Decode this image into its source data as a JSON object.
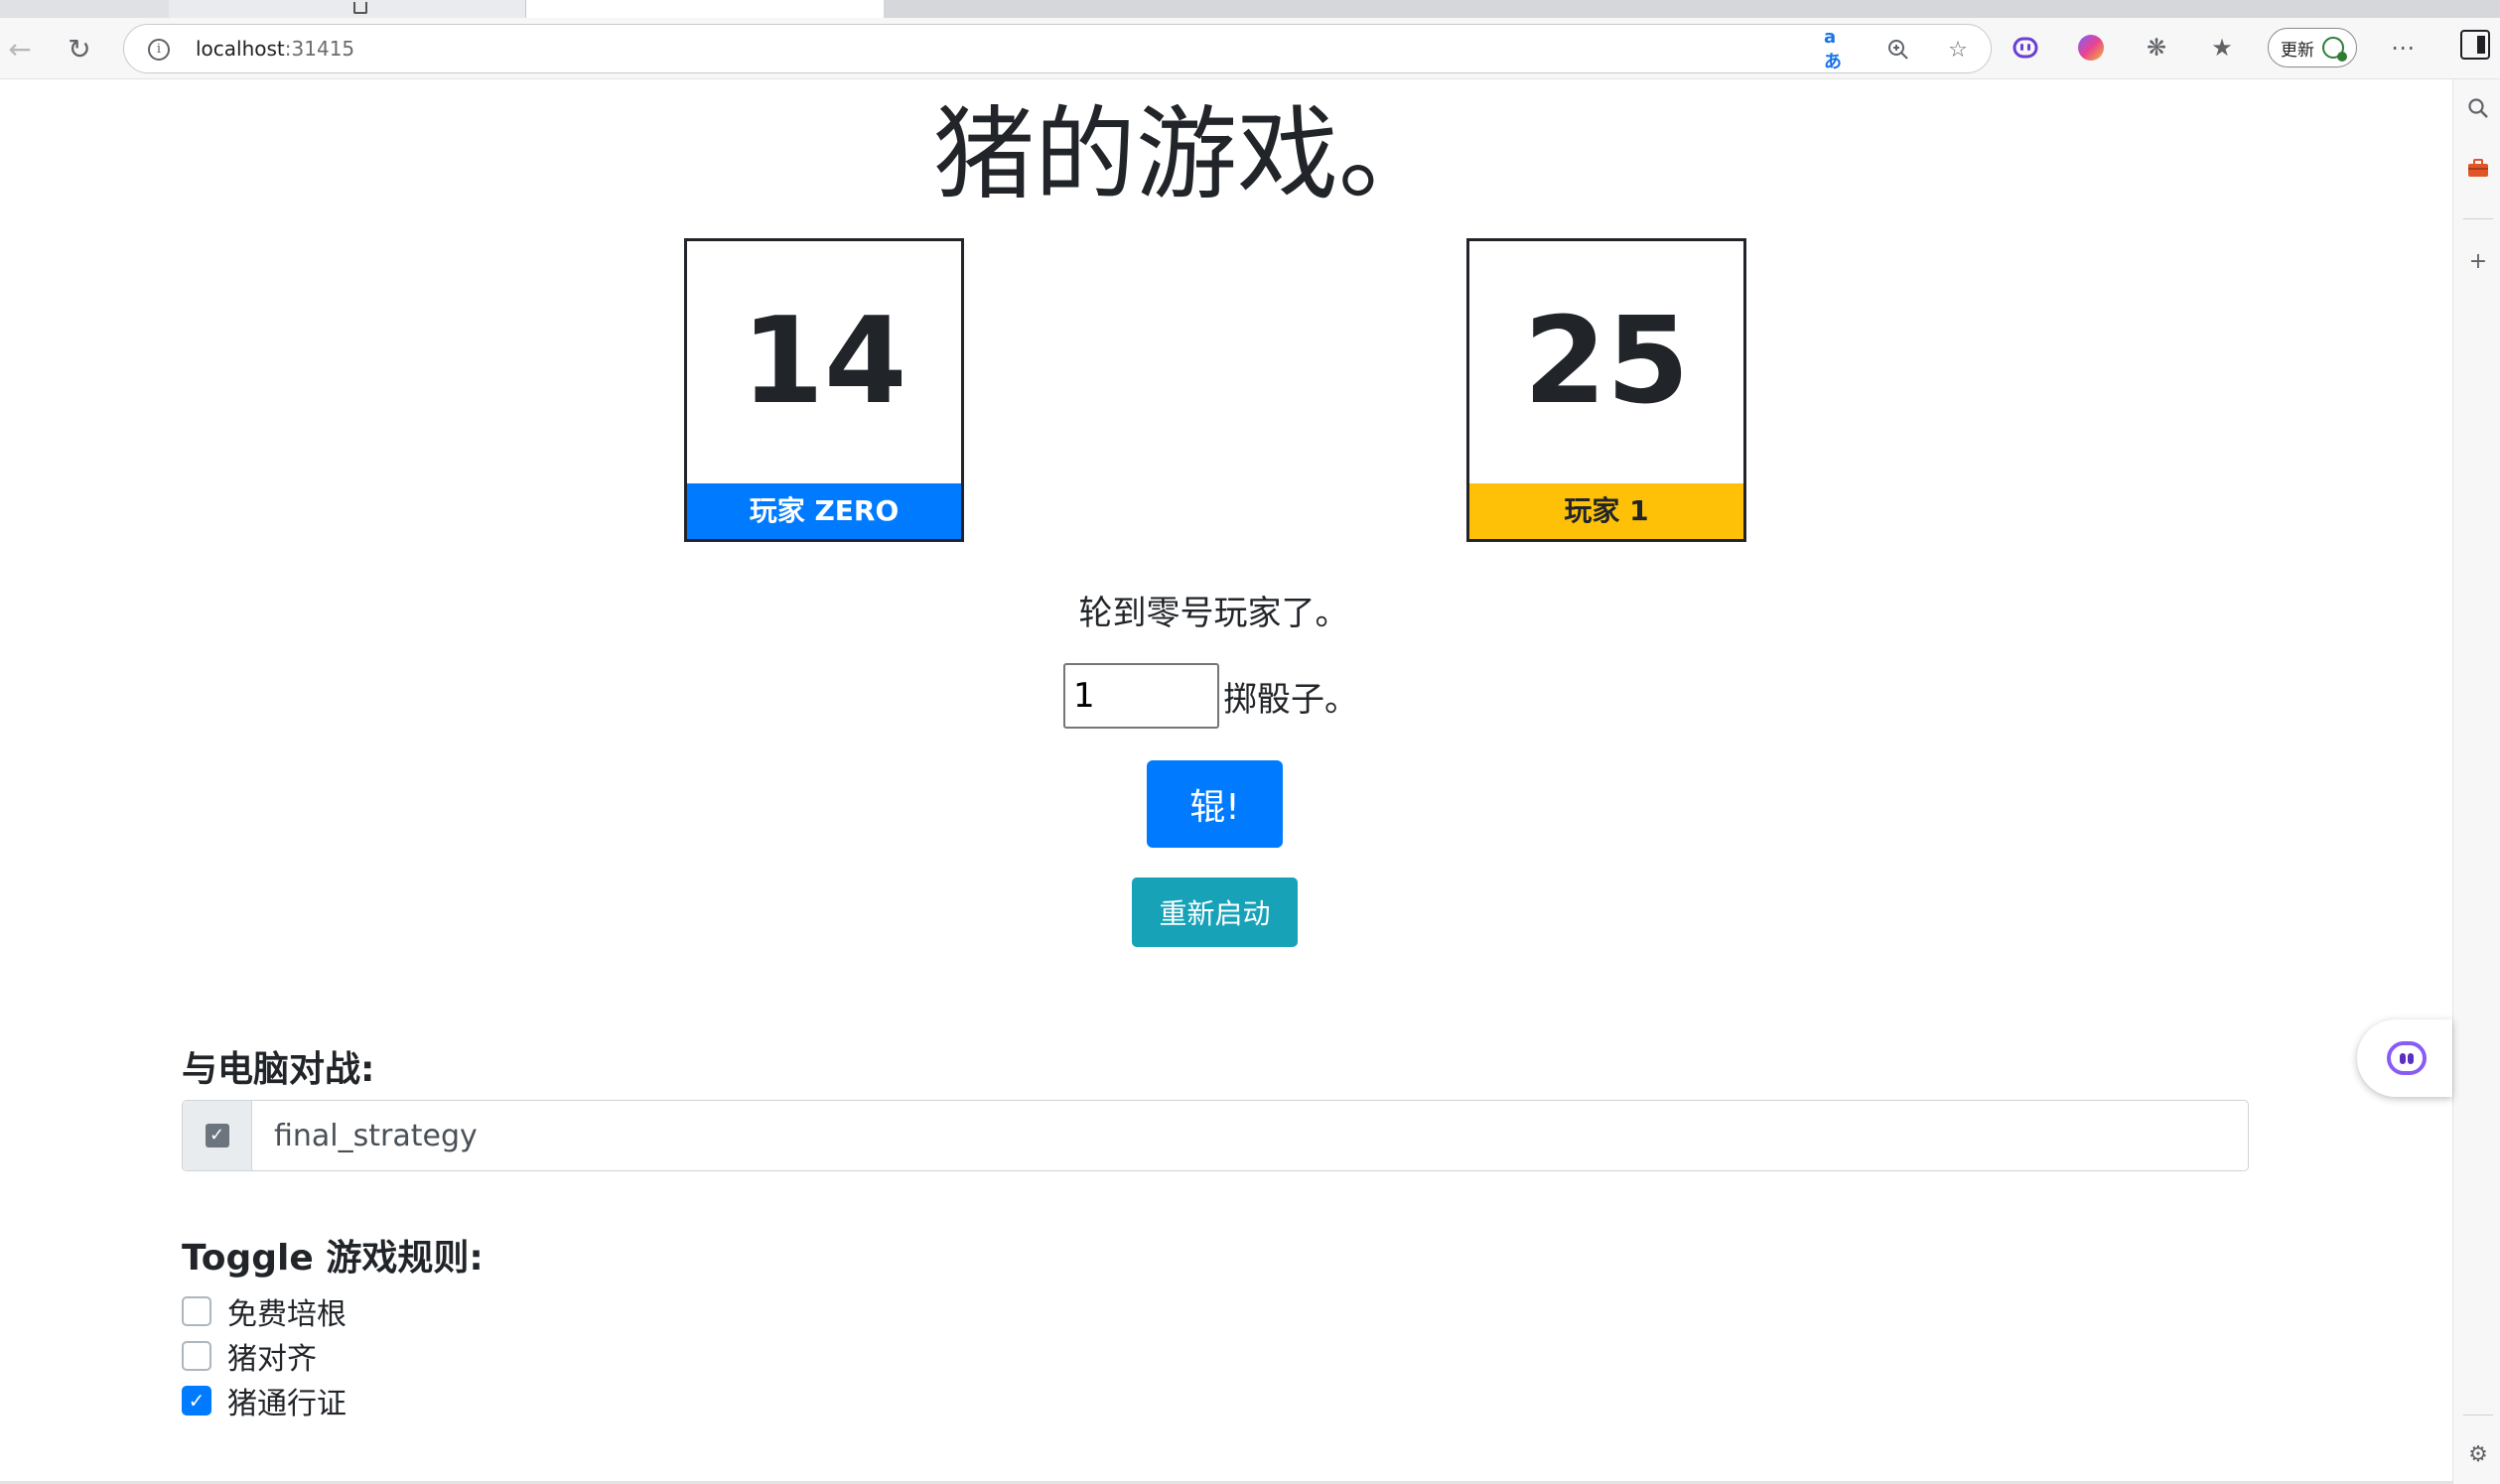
{
  "browser": {
    "url_host": "localhost",
    "url_port": ":31415",
    "update_label": "更新",
    "icons": [
      "back-icon",
      "reload-icon",
      "info-icon",
      "translate-icon",
      "zoom-icon",
      "favorite-icon",
      "copilot-face-icon",
      "copilot-logo-icon",
      "extensions-icon",
      "favorites-list-icon",
      "more-icon",
      "sidebar-toggle-icon"
    ],
    "translate_glyph": "aあ"
  },
  "sidebar": {
    "icons": [
      "search-icon",
      "toolbox-icon",
      "add-icon",
      "settings-icon"
    ]
  },
  "game": {
    "title": "猪的游戏。",
    "player0": {
      "score": "14",
      "label": "玩家 ZERO",
      "color": "#007bff"
    },
    "player1": {
      "score": "25",
      "label": "玩家 1",
      "color": "#ffc107"
    },
    "turn_text": "轮到零号玩家了。",
    "dice_value": "1",
    "dice_label": "掷骰子。",
    "roll_button": "辊!",
    "restart_button": "重新启动"
  },
  "computer": {
    "heading": "与电脑对战:",
    "strategy_value": "final_strategy",
    "strategy_enabled": true
  },
  "rules": {
    "heading": "Toggle 游戏规则:",
    "items": [
      {
        "label": "免费培根",
        "checked": false
      },
      {
        "label": "猪对齐",
        "checked": false
      },
      {
        "label": "猪通行证",
        "checked": true
      }
    ]
  }
}
